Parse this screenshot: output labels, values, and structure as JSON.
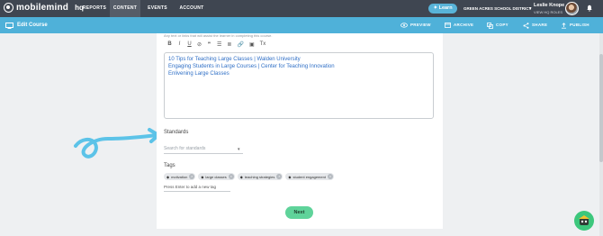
{
  "topnav": {
    "brand": "mobilemind",
    "hq": "hq",
    "items": [
      {
        "label": "REPORTS",
        "active": false
      },
      {
        "label": "CONTENT",
        "active": true
      },
      {
        "label": "EVENTS",
        "active": false
      },
      {
        "label": "ACCOUNT",
        "active": false
      }
    ],
    "learn_label": "Learn",
    "district": "GREEN ACRES SCHOOL DISTRICT",
    "user_name": "Leslie Knope",
    "user_sub": "VIEW HQ ROLES"
  },
  "subnav": {
    "title": "Edit Course",
    "actions": [
      "PREVIEW",
      "ARCHIVE",
      "COPY",
      "SHARE",
      "PUBLISH"
    ]
  },
  "form": {
    "helper": "Any text or links that will assist the learner in completing this course.",
    "toolbar": [
      "B",
      "I",
      "U",
      "⊘",
      "❞",
      "☰",
      "≣",
      "🔗",
      "▣",
      "Tx"
    ],
    "links": [
      "10 Tips for Teaching Large Classes | Walden University",
      "Engaging Students in Large Courses | Center for Teaching Innovation",
      "Enlivening Large Classes"
    ],
    "standards_label": "Standards",
    "standards_placeholder": "Search for standards",
    "tags_label": "Tags",
    "tags": [
      "motivation",
      "large classes",
      "teaching strategies",
      "student engagement"
    ],
    "tag_placeholder": "Press Enter to add a new tag",
    "next_label": "Next"
  },
  "colors": {
    "topnav": "#3f4651",
    "subnav": "#4fb1d9",
    "link": "#2f6fc6",
    "next": "#5fd39a"
  }
}
